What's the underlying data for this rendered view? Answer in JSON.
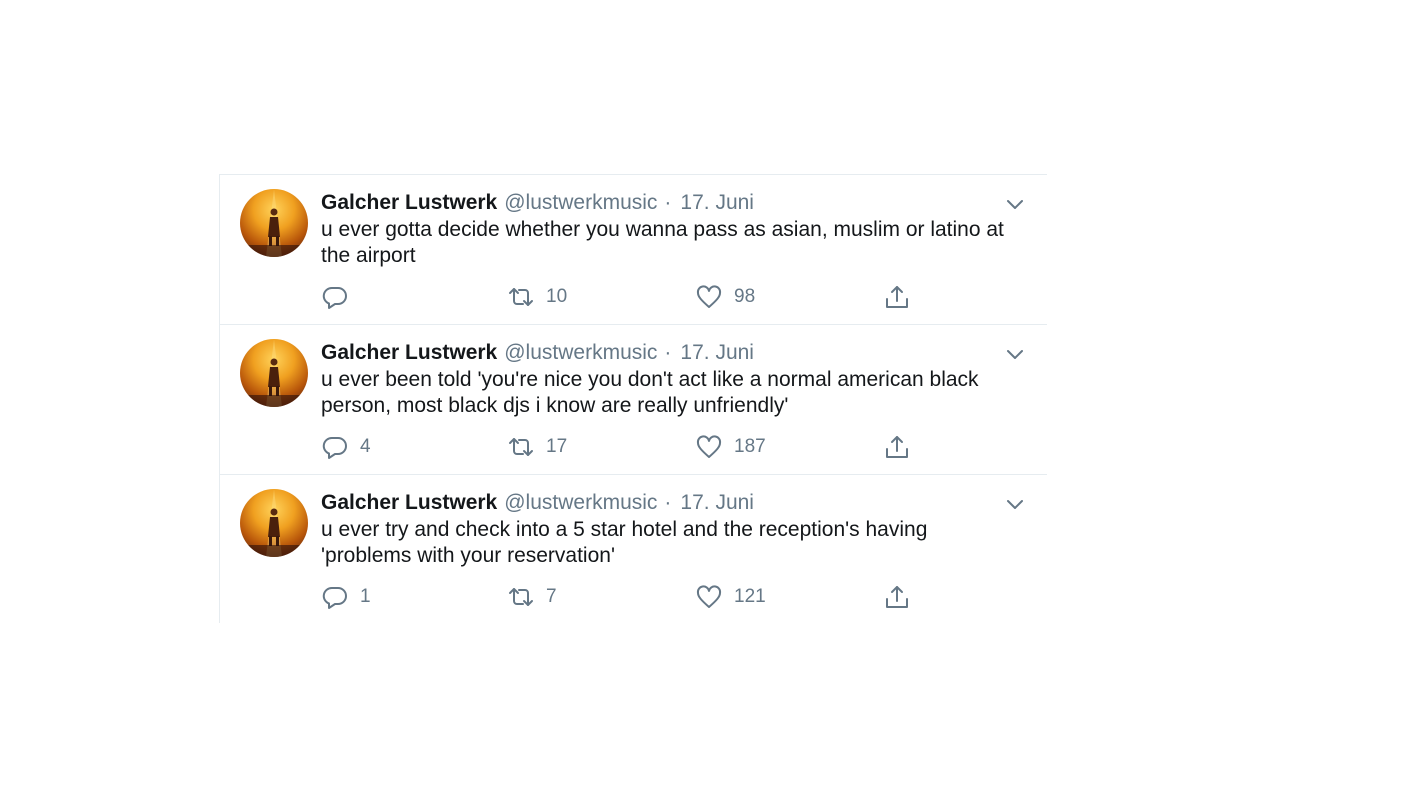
{
  "tweets": [
    {
      "author_name": "Galcher Lustwerk",
      "author_handle": "@lustwerkmusic",
      "separator": "·",
      "date": "17. Juni",
      "text": "u ever gotta decide whether you wanna pass as asian, muslim or latino at the airport",
      "replies": "",
      "retweets": "10",
      "likes": "98"
    },
    {
      "author_name": "Galcher Lustwerk",
      "author_handle": "@lustwerkmusic",
      "separator": "·",
      "date": "17. Juni",
      "text": "u ever been told 'you're nice you don't act like a normal american black person, most black djs i know are really unfriendly'",
      "replies": "4",
      "retweets": "17",
      "likes": "187"
    },
    {
      "author_name": "Galcher Lustwerk",
      "author_handle": "@lustwerkmusic",
      "separator": "·",
      "date": "17. Juni",
      "text": "u ever try and check into a 5 star hotel and the reception's having 'problems with your reservation'",
      "replies": "1",
      "retweets": "7",
      "likes": "121"
    }
  ],
  "icons": {
    "reply": "speech-bubble-icon",
    "retweet": "retweet-arrows-icon",
    "like": "heart-icon",
    "share": "share-upload-icon",
    "caret": "chevron-down-icon"
  },
  "colors": {
    "text": "#14171a",
    "secondary": "#657786",
    "divider": "#e6ecf0"
  }
}
